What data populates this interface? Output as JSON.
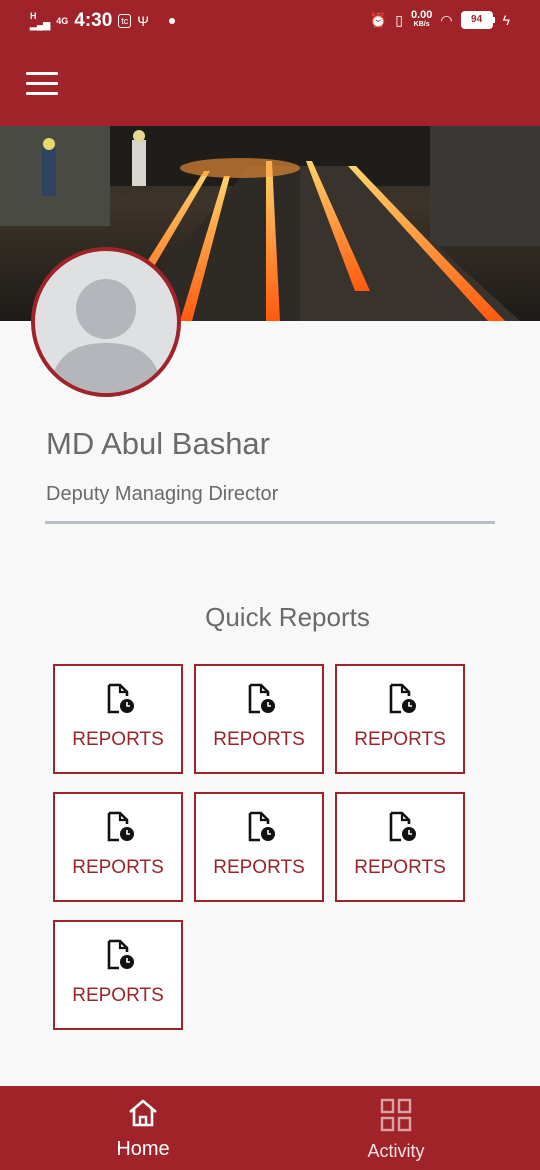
{
  "status_bar": {
    "network_label": "4G",
    "time": "4:30",
    "notification_badge": "tc",
    "data_speed": "0.00",
    "data_speed_unit": "KB/s",
    "battery": "94"
  },
  "profile": {
    "name": "MD Abul Bashar",
    "role": "Deputy Managing Director"
  },
  "quick_reports": {
    "title": "Quick Reports",
    "items": [
      {
        "label": "REPORTS"
      },
      {
        "label": "REPORTS"
      },
      {
        "label": "REPORTS"
      },
      {
        "label": "REPORTS"
      },
      {
        "label": "REPORTS"
      },
      {
        "label": "REPORTS"
      },
      {
        "label": "REPORTS"
      }
    ]
  },
  "bottom_nav": {
    "home_label": "Home",
    "activity_label": "Activity"
  },
  "colors": {
    "brand": "#a0232a",
    "tile_text": "#9b2428",
    "muted_text": "#6a6a6a",
    "background": "#f8f8f8"
  },
  "icons": {
    "menu": "hamburger-icon",
    "report": "document-clock-icon",
    "home": "home-icon",
    "activity": "grid-icon"
  }
}
